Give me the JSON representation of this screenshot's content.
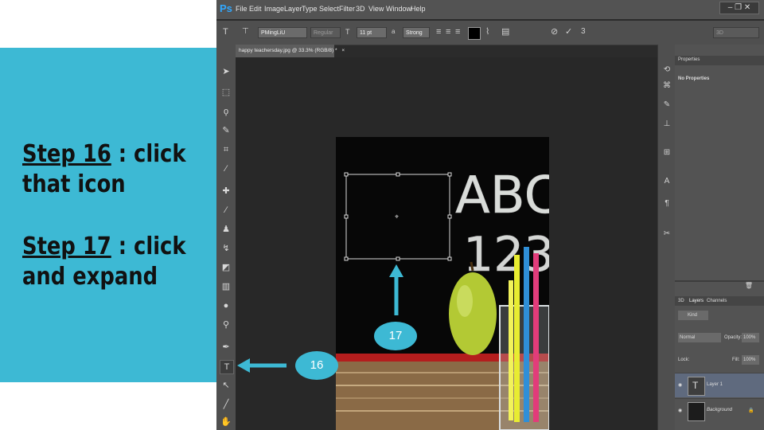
{
  "slide": {
    "step16": {
      "label": "Step 16",
      "text_line1": " : click",
      "text_line2": "that icon"
    },
    "step17": {
      "label": "Step 17",
      "text_line1": " : click",
      "text_line2": "and expand"
    }
  },
  "callouts": {
    "c16": "16",
    "c17": "17"
  },
  "app": {
    "logo": "Ps",
    "menu": [
      "File",
      "Edit",
      "Image",
      "Layer",
      "Type",
      "Select",
      "Filter",
      "3D",
      "View",
      "Window",
      "Help"
    ],
    "window_buttons": "– ❐ ✕"
  },
  "options": {
    "font_family": "PMingLiU",
    "font_style": "Regular",
    "font_size": "11 pt",
    "anti_alias": "Strong",
    "workspace": "3D"
  },
  "document_tab": "happy teachersday.jpg @ 33.3% (RGB/8) *",
  "document_tab_close": "×",
  "properties": {
    "tab": "Properties",
    "body": "No Properties"
  },
  "layers_panel": {
    "tabs": [
      "3D",
      "Layers",
      "Channels"
    ],
    "kind": "Kind",
    "blend_mode": "Normal",
    "opacity_label": "Opacity:",
    "opacity_value": "100%",
    "lock_label": "Lock:",
    "fill_label": "Fill:",
    "fill_value": "100%",
    "layers": [
      {
        "name": "Layer 1",
        "thumb": "T"
      },
      {
        "name": "Background"
      }
    ]
  },
  "photo": {
    "chalk_letters": "ABC",
    "chalk_numbers": "123"
  },
  "colors": {
    "slide_bg": "#3db9d4",
    "ps_dark": "#282828",
    "ps_panel": "#535353",
    "ps_accent": "#31a8ff"
  }
}
